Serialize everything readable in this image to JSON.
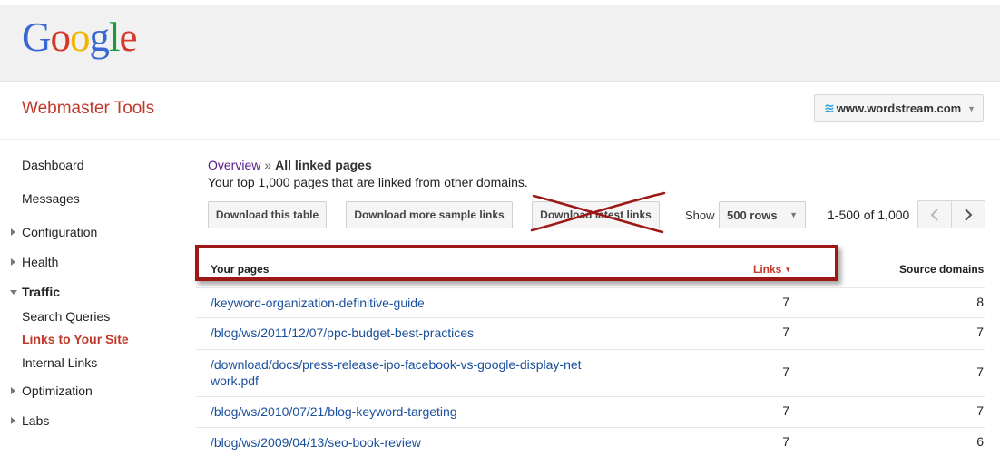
{
  "header": {
    "logo_letters": [
      "G",
      "o",
      "o",
      "g",
      "l",
      "e"
    ],
    "app_title": "Webmaster Tools",
    "site_selector": {
      "icon": "wordstream-waves-icon",
      "label": "www.wordstream.com"
    }
  },
  "sidebar": {
    "items": [
      {
        "label": "Dashboard",
        "expander": "none"
      },
      {
        "label": "Messages",
        "expander": "none"
      },
      {
        "label": "Configuration",
        "expander": "collapsed"
      },
      {
        "label": "Health",
        "expander": "collapsed"
      },
      {
        "label": "Traffic",
        "expander": "expanded"
      },
      {
        "label": "Search Queries",
        "expander": "none"
      },
      {
        "label": "Links to Your Site",
        "expander": "none",
        "active": true
      },
      {
        "label": "Internal Links",
        "expander": "none"
      },
      {
        "label": "Optimization",
        "expander": "collapsed"
      },
      {
        "label": "Labs",
        "expander": "collapsed"
      }
    ]
  },
  "main": {
    "breadcrumb": {
      "parent": "Overview",
      "separator": "»",
      "current": "All linked pages"
    },
    "subtitle": "Your top 1,000 pages that are linked from other domains.",
    "toolbar": {
      "download_table": "Download this table",
      "download_sample": "Download more sample links",
      "download_latest": "Download latest links",
      "show_label": "Show",
      "rows_value": "500 rows",
      "range_text": "1-500 of 1,000",
      "prev_icon": "chevron-left-icon",
      "next_icon": "chevron-right-icon"
    },
    "table": {
      "columns": {
        "pages": "Your pages",
        "links": "Links",
        "domains": "Source domains"
      },
      "rows": [
        {
          "page": "/keyword-organization-definitive-guide",
          "links": "7",
          "domains": "8"
        },
        {
          "page": "/blog/ws/2011/12/07/ppc-budget-best-practices",
          "links": "7",
          "domains": "7"
        },
        {
          "page": "/download/docs/press-release-ipo-facebook-vs-google-display-net\nwork.pdf",
          "links": "7",
          "domains": "7"
        },
        {
          "page": "/blog/ws/2010/07/21/blog-keyword-targeting",
          "links": "7",
          "domains": "7"
        },
        {
          "page": "/blog/ws/2009/04/13/seo-book-review",
          "links": "7",
          "domains": "6"
        }
      ]
    }
  },
  "colors": {
    "accent_red": "#c0392b",
    "link_blue": "#1a4f9c",
    "visited_purple": "#551a8b",
    "annotation_red": "#9e1818"
  }
}
